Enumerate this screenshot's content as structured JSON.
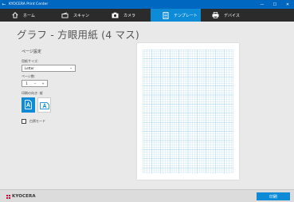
{
  "window": {
    "back_glyph": "←",
    "title": "KYOCERA Print Center",
    "minimize": "—",
    "maximize": "☐",
    "close": "✕"
  },
  "nav": {
    "items": [
      {
        "label": "ホーム",
        "icon": "home-icon"
      },
      {
        "label": "スキャン",
        "icon": "scanner-icon"
      },
      {
        "label": "カメラ",
        "icon": "camera-icon"
      },
      {
        "label": "テンプレート",
        "icon": "template-icon",
        "active": true
      },
      {
        "label": "デバイス",
        "icon": "printer-icon"
      }
    ]
  },
  "page": {
    "title": "グラフ - 方眼用紙 (4 マス)"
  },
  "settings": {
    "heading": "ページ設定",
    "paper_size_label": "用紙サイズ:",
    "paper_size_value": "Letter",
    "page_count_label": "ページ数:",
    "page_count_value": "1",
    "orientation_label": "印刷の向き: 縦",
    "monochrome_label": "白黒モード",
    "monochrome_checked": false
  },
  "footer": {
    "logo_text": "KYOCERA",
    "print_label": "印刷"
  },
  "colors": {
    "accent": "#0e8bd6",
    "titlebar": "#0067c0",
    "navbar": "#2b2b2b",
    "grid": "#8ec8ea"
  }
}
